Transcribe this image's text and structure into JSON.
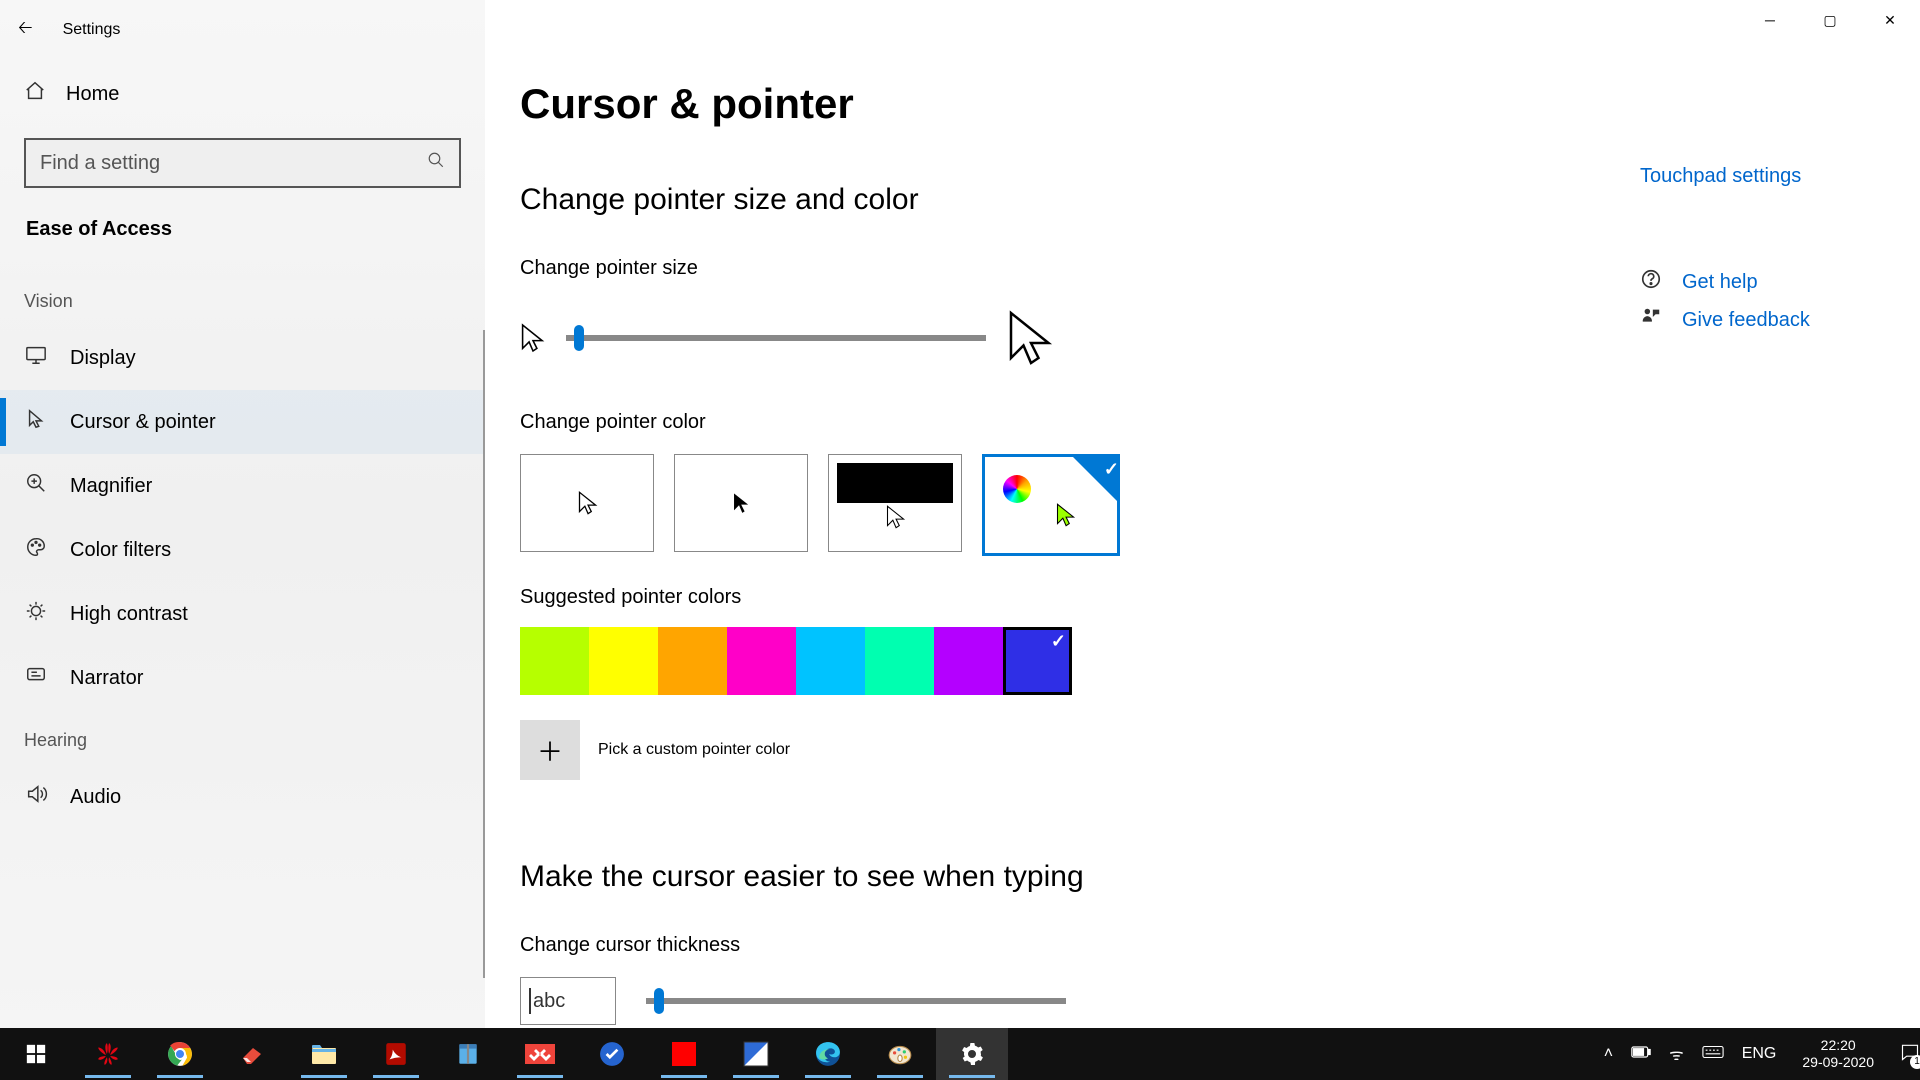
{
  "window_title": "Settings",
  "sidebar": {
    "home": "Home",
    "search_placeholder": "Find a setting",
    "heading": "Ease of Access",
    "groups": [
      {
        "title": "Vision",
        "items": [
          {
            "icon": "display-icon",
            "label": "Display",
            "active": false
          },
          {
            "icon": "cursor-icon",
            "label": "Cursor & pointer",
            "active": true
          },
          {
            "icon": "magnifier-icon",
            "label": "Magnifier",
            "active": false
          },
          {
            "icon": "palette-icon",
            "label": "Color filters",
            "active": false
          },
          {
            "icon": "contrast-icon",
            "label": "High contrast",
            "active": false
          },
          {
            "icon": "narrator-icon",
            "label": "Narrator",
            "active": false
          }
        ]
      },
      {
        "title": "Hearing",
        "items": [
          {
            "icon": "audio-icon",
            "label": "Audio",
            "active": false
          }
        ]
      }
    ]
  },
  "main": {
    "page_title": "Cursor & pointer",
    "section1_title": "Change pointer size and color",
    "pointer_size_label": "Change pointer size",
    "pointer_size_value_pct": 2,
    "pointer_color_label": "Change pointer color",
    "pointer_color_schemes": [
      {
        "id": "white",
        "selected": false
      },
      {
        "id": "black",
        "selected": false
      },
      {
        "id": "inverted",
        "selected": false
      },
      {
        "id": "custom",
        "selected": true
      }
    ],
    "suggested_label": "Suggested pointer colors",
    "suggested_colors": [
      {
        "hex": "#B6FF00",
        "selected": false
      },
      {
        "hex": "#FFFF00",
        "selected": false
      },
      {
        "hex": "#FFA500",
        "selected": false
      },
      {
        "hex": "#FF00C8",
        "selected": false
      },
      {
        "hex": "#00C3FF",
        "selected": false
      },
      {
        "hex": "#00FFB0",
        "selected": false
      },
      {
        "hex": "#B400FF",
        "selected": false
      },
      {
        "hex": "#2F2FE6",
        "selected": true
      }
    ],
    "pick_custom_label": "Pick a custom pointer color",
    "section2_title": "Make the cursor easier to see when typing",
    "thickness_label": "Change cursor thickness",
    "thickness_preview_text": "abc",
    "thickness_value_pct": 2
  },
  "right": {
    "touchpad_link": "Touchpad settings",
    "get_help": "Get help",
    "give_feedback": "Give feedback"
  },
  "taskbar": {
    "apps": [
      "start",
      "huawei",
      "chrome",
      "eraser",
      "explorer",
      "pdf",
      "notebook",
      "anydesk",
      "todo",
      "red",
      "image",
      "edge",
      "paint",
      "settings"
    ],
    "active_app_index": 13,
    "language": "ENG",
    "time": "22:20",
    "date": "29-09-2020",
    "notification_count": "1"
  }
}
